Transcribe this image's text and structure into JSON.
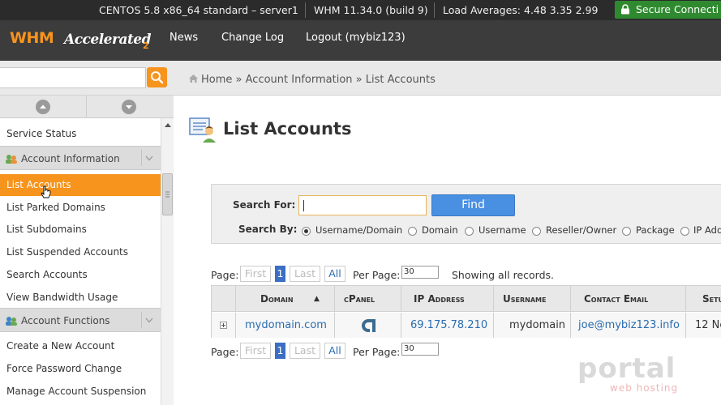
{
  "status_bar": {
    "server": "CENTOS 5.8 x86_64 standard – server1",
    "version": "WHM 11.34.0 (build 9)",
    "load": "Load Averages: 4.48 3.35 2.99",
    "secure": "Secure Connecti"
  },
  "header": {
    "logo_whm": "WHM",
    "logo_accelerated": "Accelerated",
    "logo_version": "2",
    "nav": [
      "News",
      "Change Log",
      "Logout (mybiz123)"
    ]
  },
  "breadcrumb": {
    "home": "Home",
    "sep": "»",
    "section": "Account Information",
    "page": "List Accounts"
  },
  "sidebar": {
    "search_value": "",
    "items_before": [
      "Service Status"
    ],
    "group1": "Account Information",
    "group1_items": [
      "List Accounts",
      "List Parked Domains",
      "List Subdomains",
      "List Suspended Accounts",
      "Search Accounts",
      "View Bandwidth Usage"
    ],
    "active_item": "List Accounts",
    "group2": "Account Functions",
    "group2_items": [
      "Create a New Account",
      "Force Password Change",
      "Manage Account Suspension"
    ]
  },
  "page": {
    "title": "List Accounts"
  },
  "search": {
    "search_for_label": "Search For:",
    "search_value": "",
    "find_label": "Find",
    "search_by_label": "Search By:",
    "options": [
      "Username/Domain",
      "Domain",
      "Username",
      "Reseller/Owner",
      "Package",
      "IP Add"
    ],
    "selected": "Username/Domain"
  },
  "pager": {
    "page_label": "Page:",
    "first": "First",
    "current": "1",
    "last": "Last",
    "all": "All",
    "per_page_label": "Per Page:",
    "per_page_value": "30",
    "showing": "Showing all records."
  },
  "table": {
    "columns": [
      "Domain",
      "cPanel",
      "IP Address",
      "Username",
      "Contact Email",
      "Setu"
    ],
    "sort_indicator": "▲",
    "rows": [
      {
        "domain": "mydomain.com",
        "ip": "69.175.78.210",
        "username": "mydomain",
        "email": "joe@mybiz123.info",
        "setup": "12 No"
      }
    ]
  },
  "watermark": {
    "brand": "portal",
    "tagline": "web hosting"
  },
  "colors": {
    "accent": "#f7941d",
    "header_bg": "#3c3c3c",
    "status_bg": "#2b2b2b",
    "secure_green": "#2f8a2f",
    "link": "#2a6cb0",
    "find_button": "#4a90e2"
  }
}
